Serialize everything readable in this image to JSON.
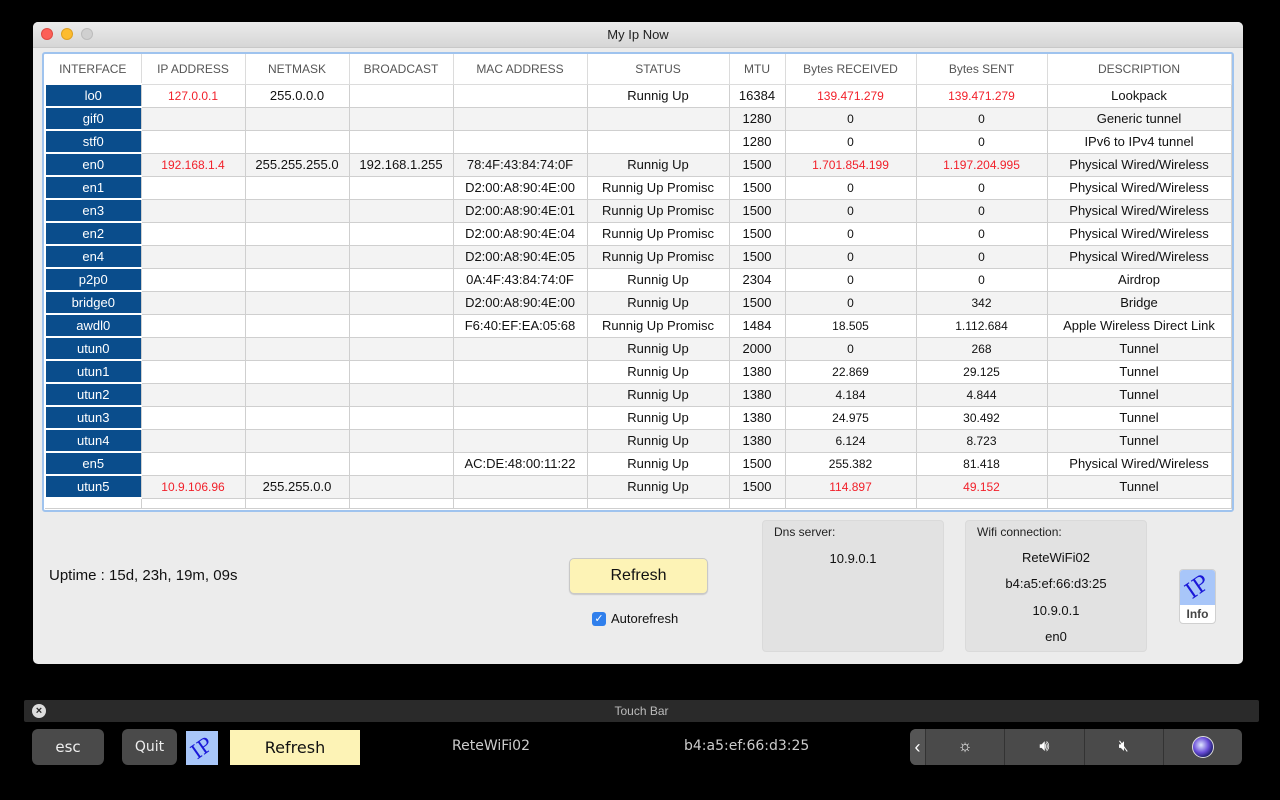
{
  "window": {
    "title": "My Ip Now"
  },
  "table": {
    "columns": [
      "INTERFACE",
      "IP ADDRESS",
      "NETMASK",
      "BROADCAST",
      "MAC ADDRESS",
      "STATUS",
      "MTU",
      "Bytes RECEIVED",
      "Bytes SENT",
      "DESCRIPTION"
    ],
    "rows": [
      {
        "iface": "lo0",
        "ip": "127.0.0.1",
        "netmask": "255.0.0.0",
        "broadcast": "",
        "mac": "",
        "status": "Runnig Up",
        "mtu": "16384",
        "rx": "139.471.279",
        "tx": "139.471.279",
        "desc": "Lookpack",
        "highlight": true
      },
      {
        "iface": "gif0",
        "ip": "",
        "netmask": "",
        "broadcast": "",
        "mac": "",
        "status": "",
        "mtu": "1280",
        "rx": "0",
        "tx": "0",
        "desc": "Generic tunnel",
        "highlight": false
      },
      {
        "iface": "stf0",
        "ip": "",
        "netmask": "",
        "broadcast": "",
        "mac": "",
        "status": "",
        "mtu": "1280",
        "rx": "0",
        "tx": "0",
        "desc": "IPv6 to IPv4 tunnel",
        "highlight": false
      },
      {
        "iface": "en0",
        "ip": "192.168.1.4",
        "netmask": "255.255.255.0",
        "broadcast": "192.168.1.255",
        "mac": "78:4F:43:84:74:0F",
        "status": "Runnig Up",
        "mtu": "1500",
        "rx": "1.701.854.199",
        "tx": "1.197.204.995",
        "desc": "Physical Wired/Wireless",
        "highlight": true
      },
      {
        "iface": "en1",
        "ip": "",
        "netmask": "",
        "broadcast": "",
        "mac": "D2:00:A8:90:4E:00",
        "status": "Runnig Up Promisc",
        "mtu": "1500",
        "rx": "0",
        "tx": "0",
        "desc": "Physical Wired/Wireless",
        "highlight": false
      },
      {
        "iface": "en3",
        "ip": "",
        "netmask": "",
        "broadcast": "",
        "mac": "D2:00:A8:90:4E:01",
        "status": "Runnig Up Promisc",
        "mtu": "1500",
        "rx": "0",
        "tx": "0",
        "desc": "Physical Wired/Wireless",
        "highlight": false
      },
      {
        "iface": "en2",
        "ip": "",
        "netmask": "",
        "broadcast": "",
        "mac": "D2:00:A8:90:4E:04",
        "status": "Runnig Up Promisc",
        "mtu": "1500",
        "rx": "0",
        "tx": "0",
        "desc": "Physical Wired/Wireless",
        "highlight": false
      },
      {
        "iface": "en4",
        "ip": "",
        "netmask": "",
        "broadcast": "",
        "mac": "D2:00:A8:90:4E:05",
        "status": "Runnig Up Promisc",
        "mtu": "1500",
        "rx": "0",
        "tx": "0",
        "desc": "Physical Wired/Wireless",
        "highlight": false
      },
      {
        "iface": "p2p0",
        "ip": "",
        "netmask": "",
        "broadcast": "",
        "mac": "0A:4F:43:84:74:0F",
        "status": "Runnig Up",
        "mtu": "2304",
        "rx": "0",
        "tx": "0",
        "desc": "Airdrop",
        "highlight": false
      },
      {
        "iface": "bridge0",
        "ip": "",
        "netmask": "",
        "broadcast": "",
        "mac": "D2:00:A8:90:4E:00",
        "status": "Runnig Up",
        "mtu": "1500",
        "rx": "0",
        "tx": "342",
        "desc": "Bridge",
        "highlight": false
      },
      {
        "iface": "awdl0",
        "ip": "",
        "netmask": "",
        "broadcast": "",
        "mac": "F6:40:EF:EA:05:68",
        "status": "Runnig Up Promisc",
        "mtu": "1484",
        "rx": "18.505",
        "tx": "1.112.684",
        "desc": "Apple Wireless Direct Link",
        "highlight": false
      },
      {
        "iface": "utun0",
        "ip": "",
        "netmask": "",
        "broadcast": "",
        "mac": "",
        "status": "Runnig Up",
        "mtu": "2000",
        "rx": "0",
        "tx": "268",
        "desc": "Tunnel",
        "highlight": false
      },
      {
        "iface": "utun1",
        "ip": "",
        "netmask": "",
        "broadcast": "",
        "mac": "",
        "status": "Runnig Up",
        "mtu": "1380",
        "rx": "22.869",
        "tx": "29.125",
        "desc": "Tunnel",
        "highlight": false
      },
      {
        "iface": "utun2",
        "ip": "",
        "netmask": "",
        "broadcast": "",
        "mac": "",
        "status": "Runnig Up",
        "mtu": "1380",
        "rx": "4.184",
        "tx": "4.844",
        "desc": "Tunnel",
        "highlight": false
      },
      {
        "iface": "utun3",
        "ip": "",
        "netmask": "",
        "broadcast": "",
        "mac": "",
        "status": "Runnig Up",
        "mtu": "1380",
        "rx": "24.975",
        "tx": "30.492",
        "desc": "Tunnel",
        "highlight": false
      },
      {
        "iface": "utun4",
        "ip": "",
        "netmask": "",
        "broadcast": "",
        "mac": "",
        "status": "Runnig Up",
        "mtu": "1380",
        "rx": "6.124",
        "tx": "8.723",
        "desc": "Tunnel",
        "highlight": false
      },
      {
        "iface": "en5",
        "ip": "",
        "netmask": "",
        "broadcast": "",
        "mac": "AC:DE:48:00:11:22",
        "status": "Runnig Up",
        "mtu": "1500",
        "rx": "255.382",
        "tx": "81.418",
        "desc": "Physical Wired/Wireless",
        "highlight": false
      },
      {
        "iface": "utun5",
        "ip": "10.9.106.96",
        "netmask": "255.255.0.0",
        "broadcast": "",
        "mac": "",
        "status": "Runnig Up",
        "mtu": "1500",
        "rx": "114.897",
        "tx": "49.152",
        "desc": "Tunnel",
        "highlight": true
      }
    ]
  },
  "uptime": "Uptime : 15d, 23h, 19m, 09s",
  "refresh_label": "Refresh",
  "autorefresh": {
    "label": "Autorefresh",
    "checked": true
  },
  "dns": {
    "title": "Dns server:",
    "value": "10.9.0.1"
  },
  "wifi": {
    "title": "Wifi connection:",
    "ssid": "ReteWiFi02",
    "bssid": "b4:a5:ef:66:d3:25",
    "ip": "10.9.0.1",
    "interface": "en0"
  },
  "info_button": {
    "logo": "IP",
    "label": "Info"
  },
  "touchbar": {
    "title": "Touch Bar",
    "esc": "esc",
    "quit": "Quit",
    "logo": "IP",
    "refresh": "Refresh",
    "ssid": "ReteWiFi02",
    "mac": "b4:a5:ef:66:d3:25",
    "controls": [
      "chevron-left-icon",
      "brightness-icon",
      "volume-icon",
      "mute-icon",
      "siri-icon"
    ]
  },
  "colors": {
    "interface_bg": "#0a4d8c",
    "highlight_text": "#f2202a",
    "refresh_bg": "#fdf3b6",
    "logo_bg": "#a8c6f9",
    "logo_fg": "#1a18d8"
  }
}
